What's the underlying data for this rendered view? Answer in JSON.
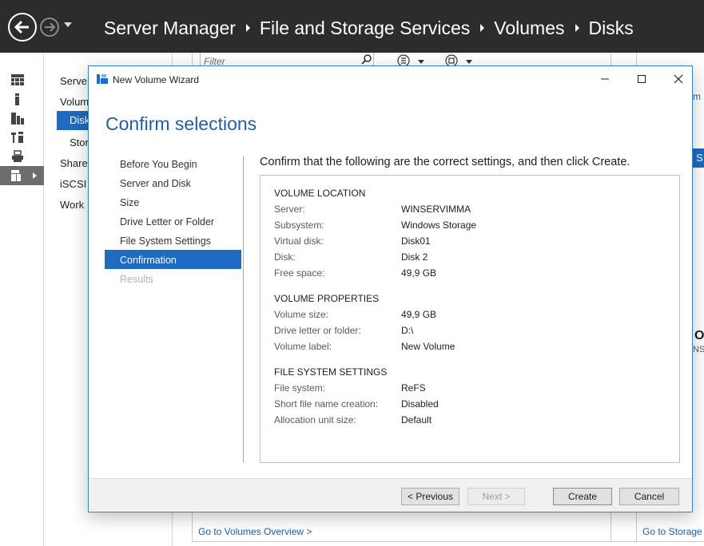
{
  "titlebar": {
    "breadcrumbs": [
      "Server Manager",
      "File and Storage Services",
      "Volumes",
      "Disks"
    ]
  },
  "secondary_nav": {
    "items": [
      {
        "label": "Servers",
        "visible": "Serve"
      },
      {
        "label": "Volumes",
        "visible": "Volum"
      },
      {
        "label": "Disks",
        "visible": "Disk"
      },
      {
        "label": "Storage Pools",
        "visible": "Stor"
      },
      {
        "label": "Shares",
        "visible": "Share"
      },
      {
        "label": "iSCSI",
        "visible": "iSCSI"
      },
      {
        "label": "Work Folders",
        "visible": "Work"
      }
    ]
  },
  "background": {
    "filter_placeholder": "Filter",
    "link_volumes": "Go to Volumes Overview >",
    "link_storage": "Go to Storage",
    "right_fragments": [
      "m",
      "S",
      "O",
      "NS"
    ]
  },
  "wizard": {
    "title": "New Volume Wizard",
    "heading": "Confirm selections",
    "steps": [
      {
        "label": "Before You Begin",
        "state": "normal"
      },
      {
        "label": "Server and Disk",
        "state": "normal"
      },
      {
        "label": "Size",
        "state": "normal"
      },
      {
        "label": "Drive Letter or Folder",
        "state": "normal"
      },
      {
        "label": "File System Settings",
        "state": "normal"
      },
      {
        "label": "Confirmation",
        "state": "selected"
      },
      {
        "label": "Results",
        "state": "disabled"
      }
    ],
    "instruction": "Confirm that the following are the correct settings, and then click Create.",
    "sections": [
      {
        "title": "VOLUME LOCATION",
        "rows": [
          {
            "label": "Server:",
            "value": "WINSERVIMMA"
          },
          {
            "label": "Subsystem:",
            "value": "Windows Storage"
          },
          {
            "label": "Virtual disk:",
            "value": "Disk01"
          },
          {
            "label": "Disk:",
            "value": "Disk 2"
          },
          {
            "label": "Free space:",
            "value": "49,9 GB"
          }
        ]
      },
      {
        "title": "VOLUME PROPERTIES",
        "rows": [
          {
            "label": "Volume size:",
            "value": "49,9 GB"
          },
          {
            "label": "Drive letter or folder:",
            "value": "D:\\"
          },
          {
            "label": "Volume label:",
            "value": "New Volume"
          }
        ]
      },
      {
        "title": "FILE SYSTEM SETTINGS",
        "rows": [
          {
            "label": "File system:",
            "value": "ReFS"
          },
          {
            "label": "Short file name creation:",
            "value": "Disabled"
          },
          {
            "label": "Allocation unit size:",
            "value": "Default"
          }
        ]
      }
    ],
    "buttons": {
      "previous": "< Previous",
      "next": "Next >",
      "create": "Create",
      "cancel": "Cancel"
    }
  },
  "colors": {
    "titlebar_bg": "#2c2c2c",
    "accent": "#1e6bc1",
    "heading": "#1e5fa8",
    "rail_selected": "#6d6d6d"
  }
}
